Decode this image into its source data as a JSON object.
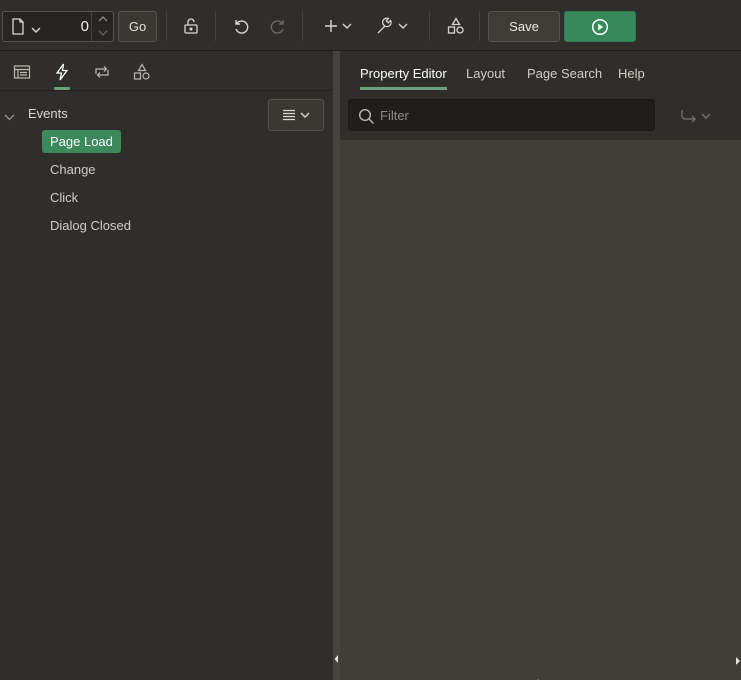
{
  "toolbar": {
    "page_number": "0",
    "go_label": "Go",
    "save_label": "Save"
  },
  "left_tabs": [
    "rendering",
    "dynamic-actions",
    "processing",
    "shared-components"
  ],
  "tree": {
    "root_label": "Events",
    "items": [
      {
        "label": "Page Load",
        "selected": true
      },
      {
        "label": "Change",
        "selected": false
      },
      {
        "label": "Click",
        "selected": false
      },
      {
        "label": "Dialog Closed",
        "selected": false
      }
    ]
  },
  "right_tabs": [
    {
      "label": "Property Editor",
      "active": true
    },
    {
      "label": "Layout",
      "active": false
    },
    {
      "label": "Page Search",
      "active": false
    },
    {
      "label": "Help",
      "active": false
    }
  ],
  "filter": {
    "placeholder": "Filter",
    "value": ""
  },
  "colors": {
    "accent_green": "#36895a",
    "tab_underline": "#6aa17e"
  }
}
